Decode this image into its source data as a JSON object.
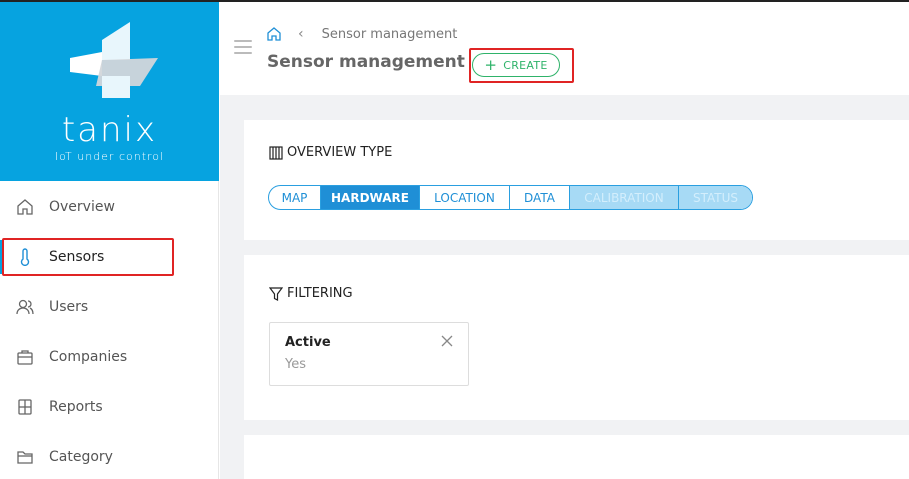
{
  "brand": {
    "name": "tanix",
    "tagline": "IoT under control",
    "color": "#06a3e0"
  },
  "sidebar": {
    "items": [
      {
        "label": "Overview",
        "icon": "home-icon"
      },
      {
        "label": "Sensors",
        "icon": "thermometer-icon",
        "active": true
      },
      {
        "label": "Users",
        "icon": "users-icon"
      },
      {
        "label": "Companies",
        "icon": "briefcase-icon"
      },
      {
        "label": "Reports",
        "icon": "report-icon"
      },
      {
        "label": "Category",
        "icon": "folder-icon"
      }
    ]
  },
  "header": {
    "breadcrumb": "Sensor management",
    "title": "Sensor management",
    "create_label": "CREATE"
  },
  "overview": {
    "title": "OVERVIEW TYPE",
    "options": [
      "MAP",
      "HARDWARE",
      "LOCATION",
      "DATA",
      "CALIBRATION",
      "STATUS"
    ],
    "active": "HARDWARE",
    "disabled": [
      "CALIBRATION",
      "STATUS"
    ]
  },
  "filtering": {
    "title": "FILTERING",
    "filters": [
      {
        "name": "Active",
        "value": "Yes"
      }
    ]
  },
  "colors": {
    "accent": "#1f8fd6",
    "create": "#2fb36a",
    "highlight": "#e02424",
    "content_bg": "#f1f2f4"
  }
}
